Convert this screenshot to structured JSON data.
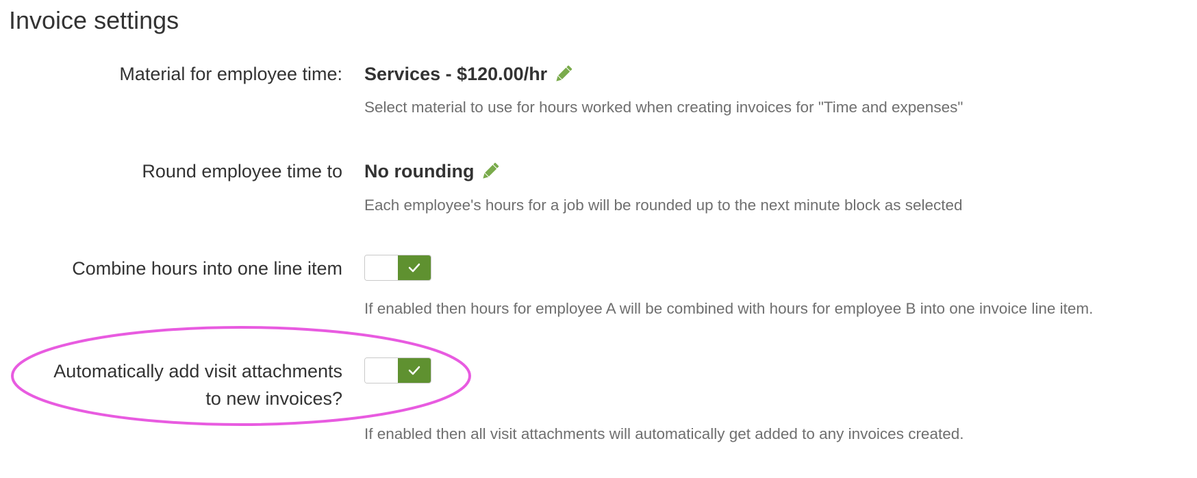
{
  "page": {
    "title": "Invoice settings"
  },
  "settings": [
    {
      "label": "Material for employee time:",
      "value": "Services - $120.00/hr",
      "help": "Select material to use for hours worked when creating invoices for \"Time and expenses\"",
      "edit_icon": "pencil-icon"
    },
    {
      "label": "Round employee time to",
      "value": "No rounding",
      "help": "Each employee's hours for a job will be rounded up to the next minute block as selected",
      "edit_icon": "pencil-icon"
    },
    {
      "label": "Combine hours into one line item",
      "toggle_state": "on",
      "help": "If enabled then hours for employee A will be combined with hours for employee B into one invoice line item."
    },
    {
      "label_line1": "Automatically add visit attachments",
      "label_line2": "to new invoices?",
      "toggle_state": "on",
      "help": "If enabled then all visit attachments will automatically get added to any invoices created."
    }
  ],
  "colors": {
    "toggle_on": "#5f9130",
    "edit_icon": "#7aab4c",
    "highlight": "#e85be0",
    "help_text": "#6f6f6f"
  }
}
